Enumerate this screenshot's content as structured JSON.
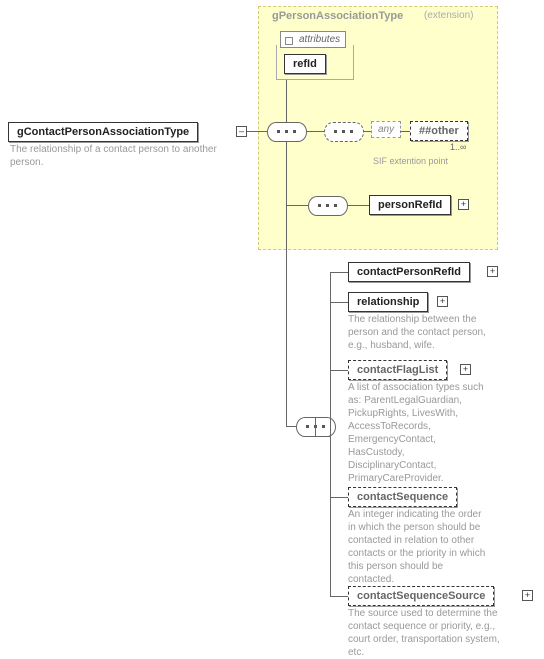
{
  "root": {
    "label": "gContactPersonAssociationType",
    "desc": "The relationship of a contact person to another person."
  },
  "extension": {
    "title": "gPersonAssociationType",
    "hint": "(extension)",
    "attributes_label": "attributes",
    "refId": "refId",
    "any_label": "any",
    "other_label": "##other",
    "any_card": "1..∞",
    "any_note": "SIF extention point",
    "personRefId": "personRefId"
  },
  "children": {
    "contactPersonRefId": {
      "label": "contactPersonRefId"
    },
    "relationship": {
      "label": "relationship",
      "desc": "The relationship between the person and the contact person, e.g., husband, wife."
    },
    "contactFlagList": {
      "label": "contactFlagList",
      "desc": "A list of association types such as: ParentLegalGuardian, PickupRights, LivesWith, AccessToRecords, EmergencyContact, HasCustody, DisciplinaryContact, PrimaryCareProvider."
    },
    "contactSequence": {
      "label": "contactSequence",
      "desc": "An integer indicating the order in which the person should be contacted in relation to other contacts or the priority in which this person should be contacted."
    },
    "contactSequenceSource": {
      "label": "contactSequenceSource",
      "desc": "The source used to determine the contact sequence or priority, e.g., court order, transportation system, etc."
    }
  }
}
